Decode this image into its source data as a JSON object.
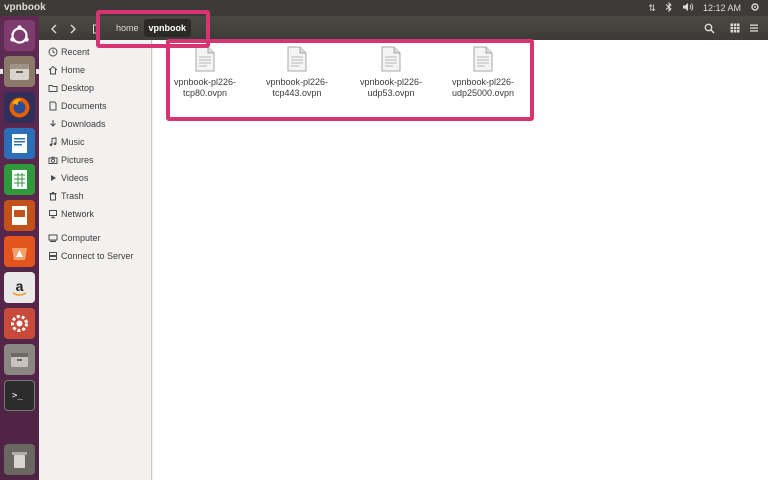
{
  "window": {
    "title": "vpnbook"
  },
  "panel": {
    "network_icon": "transfer-arrows-icon",
    "bluetooth_icon": "bluetooth-icon",
    "volume_icon": "volume-icon",
    "time": "12:12 AM",
    "settings_icon": "power-gear-icon"
  },
  "breadcrumb": {
    "items": [
      "home",
      "vpnbook"
    ],
    "active": "vpnbook"
  },
  "sidebar": {
    "items": [
      {
        "label": "Recent",
        "icon": "clock-icon"
      },
      {
        "label": "Home",
        "icon": "home-icon"
      },
      {
        "label": "Desktop",
        "icon": "folder-icon"
      },
      {
        "label": "Documents",
        "icon": "document-icon"
      },
      {
        "label": "Downloads",
        "icon": "download-icon"
      },
      {
        "label": "Music",
        "icon": "music-icon"
      },
      {
        "label": "Pictures",
        "icon": "camera-icon"
      },
      {
        "label": "Videos",
        "icon": "video-icon"
      },
      {
        "label": "Trash",
        "icon": "trash-icon"
      },
      {
        "label": "Network",
        "icon": "network-icon"
      },
      {
        "label": "Computer",
        "icon": "computer-icon"
      },
      {
        "label": "Connect to Server",
        "icon": "server-icon"
      }
    ]
  },
  "files": [
    {
      "name": "vpnbook-pl226-\ntcp80.ovpn"
    },
    {
      "name": "vpnbook-pl226-\ntcp443.ovpn"
    },
    {
      "name": "vpnbook-pl226-\nudp53.ovpn"
    },
    {
      "name": "vpnbook-pl226-\nudp25000.ovpn"
    }
  ],
  "colors": {
    "highlight": "#d63473",
    "launcher": "#5e2a52",
    "panel": "#3c3b37"
  }
}
